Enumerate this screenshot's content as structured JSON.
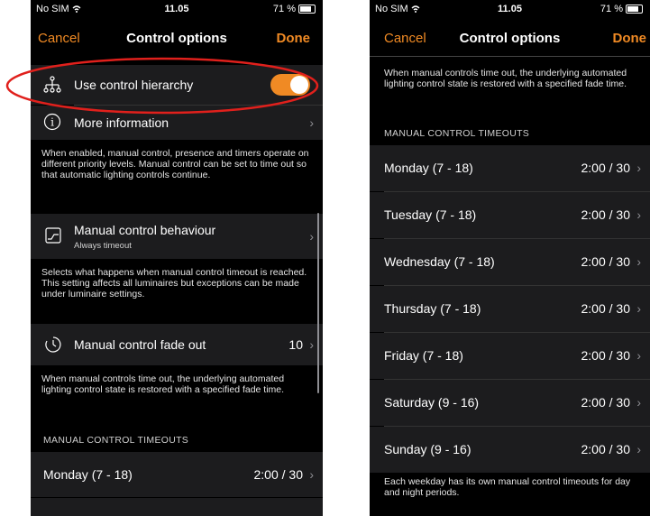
{
  "left": {
    "status": {
      "carrier": "No SIM",
      "time": "11.05",
      "battery": "71 %"
    },
    "nav": {
      "cancel": "Cancel",
      "title": "Control options",
      "done": "Done"
    },
    "hierarchy": {
      "label": "Use control hierarchy",
      "enabled": true
    },
    "more_info": {
      "label": "More information"
    },
    "hierarchy_note": "When enabled, manual control, presence and timers operate on different priority levels. Manual control can be set to time out so that automatic lighting controls continue.",
    "behaviour": {
      "label": "Manual control behaviour",
      "sub": "Always timeout"
    },
    "behaviour_note": "Selects what happens when manual control timeout is reached. This setting affects all luminaires but exceptions can be made under luminaire settings.",
    "fade": {
      "label": "Manual control fade out",
      "value": "10"
    },
    "fade_note": "When manual controls time out, the underlying automated lighting control state is restored with a specified fade time.",
    "timeouts_header": "MANUAL CONTROL TIMEOUTS",
    "monday": {
      "label": "Monday (7 - 18)",
      "value": "2:00 / 30"
    }
  },
  "right": {
    "status": {
      "carrier": "No SIM",
      "time": "11.05",
      "battery": "71 %"
    },
    "nav": {
      "cancel": "Cancel",
      "title": "Control options",
      "done": "Done"
    },
    "fade_note": "When manual controls time out, the underlying automated lighting control state is restored with a specified fade time.",
    "timeouts_header": "MANUAL CONTROL TIMEOUTS",
    "days": [
      {
        "label": "Monday (7 - 18)",
        "value": "2:00 / 30"
      },
      {
        "label": "Tuesday (7 - 18)",
        "value": "2:00 / 30"
      },
      {
        "label": "Wednesday (7 - 18)",
        "value": "2:00 / 30"
      },
      {
        "label": "Thursday (7 - 18)",
        "value": "2:00 / 30"
      },
      {
        "label": "Friday (7 - 18)",
        "value": "2:00 / 30"
      },
      {
        "label": "Saturday (9 - 16)",
        "value": "2:00 / 30"
      },
      {
        "label": "Sunday (9 - 16)",
        "value": "2:00 / 30"
      }
    ],
    "footer_note": "Each weekday has its own manual control timeouts for day and night periods."
  },
  "colors": {
    "accent": "#f08a24",
    "highlight": "#e0201c",
    "cell": "#1c1c1e",
    "background": "#000000"
  },
  "icons": [
    "wifi-icon",
    "battery-icon",
    "hierarchy-icon",
    "info-icon",
    "chevron-right-icon",
    "chart-icon",
    "timer-icon"
  ]
}
